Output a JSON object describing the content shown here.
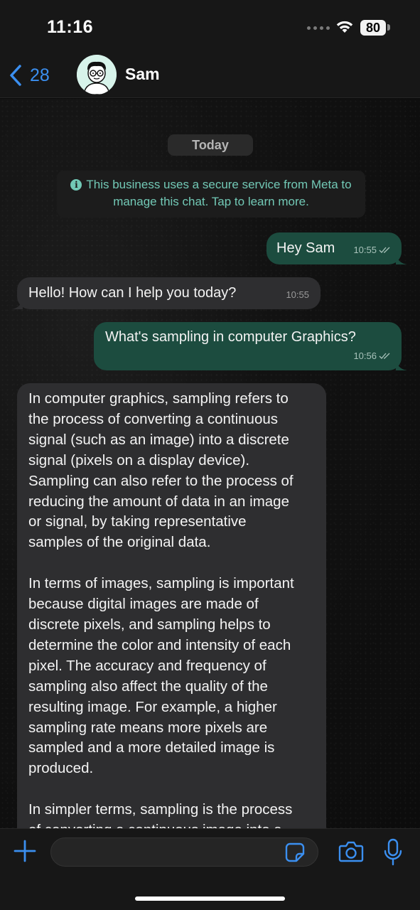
{
  "status_bar": {
    "time": "11:16",
    "battery": "80"
  },
  "header": {
    "back_count": "28",
    "contact_name": "Sam"
  },
  "chat": {
    "date_label": "Today",
    "system_notice": "This business uses a secure service from Meta to manage this chat. Tap to learn more.",
    "messages": [
      {
        "direction": "outgoing",
        "text": "Hey Sam",
        "time": "10:55",
        "status": "read"
      },
      {
        "direction": "incoming",
        "text": "Hello! How can I help you today?",
        "time": "10:55"
      },
      {
        "direction": "outgoing",
        "text": "What's sampling in computer Graphics?",
        "time": "10:56",
        "status": "read"
      },
      {
        "direction": "incoming",
        "text": "In computer graphics, sampling refers to\nthe process of converting a continuous\nsignal (such as an image) into a discrete\nsignal (pixels on a display device).\nSampling can also refer to the process of\nreducing the amount of data in an image\nor signal, by taking representative\nsamples of the original data.\n\nIn terms of images, sampling is important\nbecause digital images are made of\ndiscrete pixels, and sampling helps to\ndetermine the color and intensity of each\npixel. The accuracy and frequency of\nsampling also affect the quality of the\nresulting image. For example, a higher\nsampling rate means more pixels are\nsampled and a more detailed image is\nproduced.\n\nIn simpler terms, sampling is the process\nof converting a continuous image into a"
      }
    ]
  },
  "input": {
    "value": "",
    "placeholder": ""
  },
  "colors": {
    "accent": "#3b8ff0",
    "outgoing_bubble": "#1c4c3f",
    "incoming_bubble": "#2e2e30",
    "notice_text": "#72c9b6"
  },
  "icons": {
    "back": "chevron-left-icon",
    "wifi": "wifi-icon",
    "info": "info-icon",
    "read_receipt": "double-check-icon",
    "attach": "plus-icon",
    "sticker": "sticker-icon",
    "camera": "camera-icon",
    "mic": "microphone-icon"
  }
}
